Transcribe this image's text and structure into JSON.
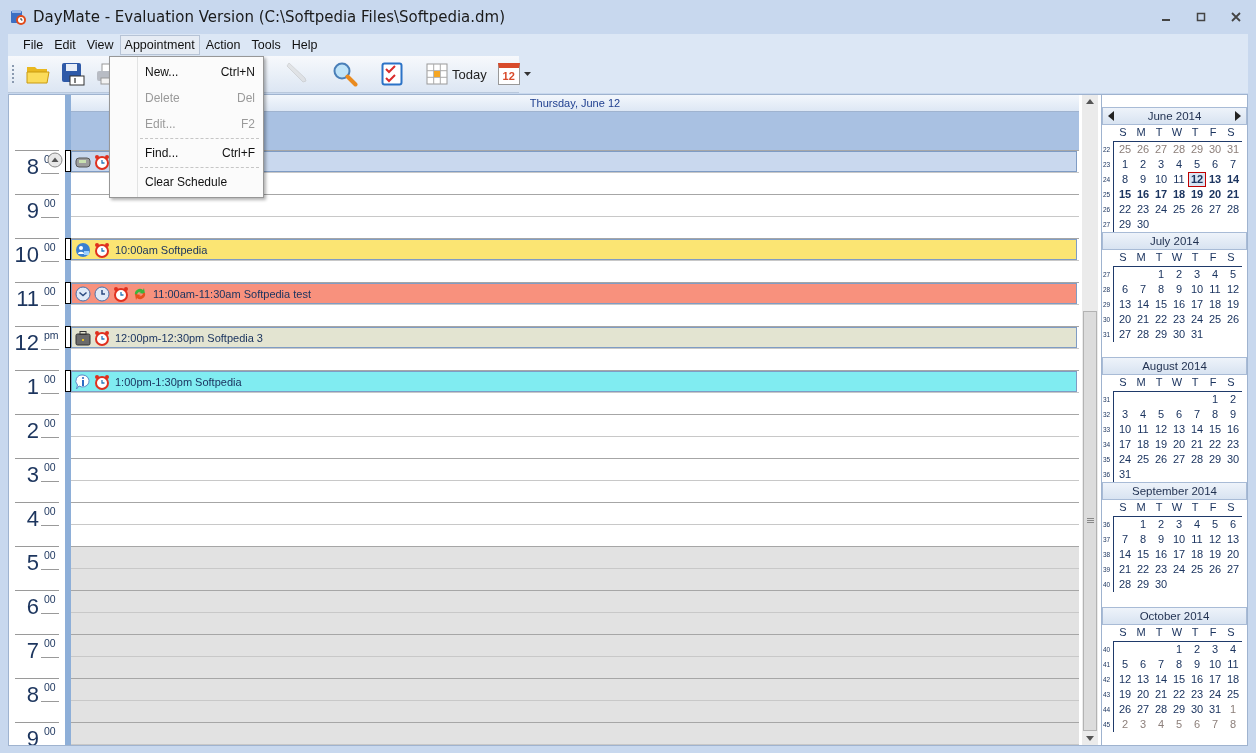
{
  "window": {
    "title": "DayMate - Evaluation Version (C:\\Softpedia Files\\Softpedia.dm)"
  },
  "menu_bar": [
    {
      "label": "File",
      "selected": false
    },
    {
      "label": "Edit",
      "selected": false
    },
    {
      "label": "View",
      "selected": false
    },
    {
      "label": "Appointment",
      "selected": true
    },
    {
      "label": "Action",
      "selected": false
    },
    {
      "label": "Tools",
      "selected": false
    },
    {
      "label": "Help",
      "selected": false
    }
  ],
  "toolbar": [
    {
      "kind": "open",
      "disabled": false
    },
    {
      "kind": "save",
      "disabled": false
    },
    {
      "kind": "print",
      "disabled": false
    },
    {
      "kind": "edit",
      "disabled": true
    },
    {
      "kind": "find",
      "disabled": false
    },
    {
      "kind": "tasks",
      "disabled": false
    },
    {
      "kind": "today",
      "label": "Today",
      "disabled": false
    },
    {
      "kind": "calendar",
      "label": "12",
      "disabled": false
    }
  ],
  "open_menu": [
    {
      "kind": "item",
      "label": "New...",
      "shortcut": "Ctrl+N",
      "disabled": false
    },
    {
      "kind": "item",
      "label": "Delete",
      "shortcut": "Del",
      "disabled": true
    },
    {
      "kind": "item",
      "label": "Edit...",
      "shortcut": "F2",
      "disabled": true
    },
    {
      "kind": "separator"
    },
    {
      "kind": "item",
      "label": "Find...",
      "shortcut": "Ctrl+F",
      "disabled": false
    },
    {
      "kind": "separator"
    },
    {
      "kind": "item",
      "label": "Clear Schedule",
      "disabled": false
    }
  ],
  "day_view": {
    "header": "Thursday, June 12",
    "hours": [
      {
        "hour": "8",
        "minutes": "0",
        "off": false,
        "appointment": {
          "kind": "message",
          "color": "#c9d8ee",
          "alarm": true,
          "recurring": false,
          "clock": false
        }
      },
      {
        "hour": "9",
        "minutes": "00",
        "off": false
      },
      {
        "hour": "10",
        "minutes": "00",
        "off": false,
        "appointment": {
          "kind": "call",
          "color": "#fbe573",
          "alarm": true,
          "recurring": false,
          "clock": false,
          "title": "10:00am Softpedia"
        }
      },
      {
        "hour": "11",
        "minutes": "00",
        "off": false,
        "appointment": {
          "kind": "reminder",
          "color": "#f8917d",
          "alarm": true,
          "recurring": true,
          "clock": true,
          "title": "11:00am-11:30am Softpedia test"
        }
      },
      {
        "hour": "12",
        "minutes": "pm",
        "off": false,
        "appointment": {
          "kind": "business",
          "color": "#e3e4d1",
          "alarm": true,
          "recurring": false,
          "clock": false,
          "title": "12:00pm-12:30pm Softpedia 3"
        }
      },
      {
        "hour": "1",
        "minutes": "00",
        "off": false,
        "appointment": {
          "kind": "info",
          "color": "#80ecf1",
          "alarm": true,
          "recurring": false,
          "clock": false,
          "title": "1:00pm-1:30pm Softpedia"
        }
      },
      {
        "hour": "2",
        "minutes": "00",
        "off": false
      },
      {
        "hour": "3",
        "minutes": "00",
        "off": false
      },
      {
        "hour": "4",
        "minutes": "00",
        "off": false
      },
      {
        "hour": "5",
        "minutes": "00",
        "off": true
      },
      {
        "hour": "6",
        "minutes": "00",
        "off": true
      },
      {
        "hour": "7",
        "minutes": "00",
        "off": true
      },
      {
        "hour": "8",
        "minutes": "00",
        "off": true
      },
      {
        "hour": "9",
        "minutes": "00",
        "off": true
      }
    ]
  },
  "mini_calendars": [
    {
      "title": "June 2014",
      "nav": true,
      "weekdays": [
        "S",
        "M",
        "T",
        "W",
        "T",
        "F",
        "S"
      ],
      "weeks": [
        {
          "wk": "22",
          "days": [
            {
              "t": "25",
              "muted": true,
              "bold": false,
              "selected": false
            },
            {
              "t": "26",
              "muted": true,
              "bold": false,
              "selected": false
            },
            {
              "t": "27",
              "muted": true,
              "bold": false,
              "selected": false
            },
            {
              "t": "28",
              "muted": true,
              "bold": false,
              "selected": false
            },
            {
              "t": "29",
              "muted": true,
              "bold": false,
              "selected": false
            },
            {
              "t": "30",
              "muted": true,
              "bold": false,
              "selected": false
            },
            {
              "t": "31",
              "muted": true,
              "bold": false,
              "selected": false
            }
          ]
        },
        {
          "wk": "23",
          "days": [
            {
              "t": "1",
              "muted": false,
              "bold": false,
              "selected": false
            },
            {
              "t": "2",
              "muted": false,
              "bold": false,
              "selected": false
            },
            {
              "t": "3",
              "muted": false,
              "bold": false,
              "selected": false
            },
            {
              "t": "4",
              "muted": false,
              "bold": false,
              "selected": false
            },
            {
              "t": "5",
              "muted": false,
              "bold": false,
              "selected": false
            },
            {
              "t": "6",
              "muted": false,
              "bold": false,
              "selected": false
            },
            {
              "t": "7",
              "muted": false,
              "bold": false,
              "selected": false
            }
          ]
        },
        {
          "wk": "24",
          "days": [
            {
              "t": "8",
              "muted": false,
              "bold": false,
              "selected": false
            },
            {
              "t": "9",
              "muted": false,
              "bold": false,
              "selected": false
            },
            {
              "t": "10",
              "muted": false,
              "bold": false,
              "selected": false
            },
            {
              "t": "11",
              "muted": false,
              "bold": false,
              "selected": false
            },
            {
              "t": "12",
              "muted": false,
              "bold": true,
              "selected": true
            },
            {
              "t": "13",
              "muted": false,
              "bold": true,
              "selected": false
            },
            {
              "t": "14",
              "muted": false,
              "bold": true,
              "selected": false
            }
          ]
        },
        {
          "wk": "25",
          "days": [
            {
              "t": "15",
              "muted": false,
              "bold": true,
              "selected": false
            },
            {
              "t": "16",
              "muted": false,
              "bold": true,
              "selected": false
            },
            {
              "t": "17",
              "muted": false,
              "bold": true,
              "selected": false
            },
            {
              "t": "18",
              "muted": false,
              "bold": true,
              "selected": false
            },
            {
              "t": "19",
              "muted": false,
              "bold": true,
              "selected": false
            },
            {
              "t": "20",
              "muted": false,
              "bold": true,
              "selected": false
            },
            {
              "t": "21",
              "muted": false,
              "bold": true,
              "selected": false
            }
          ]
        },
        {
          "wk": "26",
          "days": [
            {
              "t": "22",
              "muted": false,
              "bold": false,
              "selected": false
            },
            {
              "t": "23",
              "muted": false,
              "bold": false,
              "selected": false
            },
            {
              "t": "24",
              "muted": false,
              "bold": false,
              "selected": false
            },
            {
              "t": "25",
              "muted": false,
              "bold": false,
              "selected": false
            },
            {
              "t": "26",
              "muted": false,
              "bold": false,
              "selected": false
            },
            {
              "t": "27",
              "muted": false,
              "bold": false,
              "selected": false
            },
            {
              "t": "28",
              "muted": false,
              "bold": false,
              "selected": false
            }
          ]
        },
        {
          "wk": "27",
          "days": [
            {
              "t": "29",
              "muted": false,
              "bold": false,
              "selected": false
            },
            {
              "t": "30",
              "muted": false,
              "bold": false,
              "selected": false
            }
          ]
        }
      ]
    },
    {
      "title": "July 2014",
      "nav": false,
      "weekdays": [
        "S",
        "M",
        "T",
        "W",
        "T",
        "F",
        "S"
      ],
      "weeks": [
        {
          "wk": "27",
          "days": [
            {
              "blank": true
            },
            {
              "blank": true
            },
            {
              "t": "1",
              "muted": false,
              "bold": false,
              "selected": false
            },
            {
              "t": "2",
              "muted": false,
              "bold": false,
              "selected": false
            },
            {
              "t": "3",
              "muted": false,
              "bold": false,
              "selected": false
            },
            {
              "t": "4",
              "muted": false,
              "bold": false,
              "selected": false
            },
            {
              "t": "5",
              "muted": false,
              "bold": false,
              "selected": false
            }
          ]
        },
        {
          "wk": "28",
          "days": [
            {
              "t": "6",
              "muted": false,
              "bold": false,
              "selected": false
            },
            {
              "t": "7",
              "muted": false,
              "bold": false,
              "selected": false
            },
            {
              "t": "8",
              "muted": false,
              "bold": false,
              "selected": false
            },
            {
              "t": "9",
              "muted": false,
              "bold": false,
              "selected": false
            },
            {
              "t": "10",
              "muted": false,
              "bold": false,
              "selected": false
            },
            {
              "t": "11",
              "muted": false,
              "bold": false,
              "selected": false
            },
            {
              "t": "12",
              "muted": false,
              "bold": false,
              "selected": false
            }
          ]
        },
        {
          "wk": "29",
          "days": [
            {
              "t": "13",
              "muted": false,
              "bold": false,
              "selected": false
            },
            {
              "t": "14",
              "muted": false,
              "bold": false,
              "selected": false
            },
            {
              "t": "15",
              "muted": false,
              "bold": false,
              "selected": false
            },
            {
              "t": "16",
              "muted": false,
              "bold": false,
              "selected": false
            },
            {
              "t": "17",
              "muted": false,
              "bold": false,
              "selected": false
            },
            {
              "t": "18",
              "muted": false,
              "bold": false,
              "selected": false
            },
            {
              "t": "19",
              "muted": false,
              "bold": false,
              "selected": false
            }
          ]
        },
        {
          "wk": "30",
          "days": [
            {
              "t": "20",
              "muted": false,
              "bold": false,
              "selected": false
            },
            {
              "t": "21",
              "muted": false,
              "bold": false,
              "selected": false
            },
            {
              "t": "22",
              "muted": false,
              "bold": false,
              "selected": false
            },
            {
              "t": "23",
              "muted": false,
              "bold": false,
              "selected": false
            },
            {
              "t": "24",
              "muted": false,
              "bold": false,
              "selected": false
            },
            {
              "t": "25",
              "muted": false,
              "bold": false,
              "selected": false
            },
            {
              "t": "26",
              "muted": false,
              "bold": false,
              "selected": false
            }
          ]
        },
        {
          "wk": "31",
          "days": [
            {
              "t": "27",
              "muted": false,
              "bold": false,
              "selected": false
            },
            {
              "t": "28",
              "muted": false,
              "bold": false,
              "selected": false
            },
            {
              "t": "29",
              "muted": false,
              "bold": false,
              "selected": false
            },
            {
              "t": "30",
              "muted": false,
              "bold": false,
              "selected": false
            },
            {
              "t": "31",
              "muted": false,
              "bold": false,
              "selected": false
            }
          ]
        }
      ]
    },
    {
      "title": "August 2014",
      "nav": false,
      "weekdays": [
        "S",
        "M",
        "T",
        "W",
        "T",
        "F",
        "S"
      ],
      "weeks": [
        {
          "wk": "31",
          "days": [
            {
              "blank": true
            },
            {
              "blank": true
            },
            {
              "blank": true
            },
            {
              "blank": true
            },
            {
              "blank": true
            },
            {
              "t": "1",
              "muted": false,
              "bold": false,
              "selected": false
            },
            {
              "t": "2",
              "muted": false,
              "bold": false,
              "selected": false
            }
          ]
        },
        {
          "wk": "32",
          "days": [
            {
              "t": "3",
              "muted": false,
              "bold": false,
              "selected": false
            },
            {
              "t": "4",
              "muted": false,
              "bold": false,
              "selected": false
            },
            {
              "t": "5",
              "muted": false,
              "bold": false,
              "selected": false
            },
            {
              "t": "6",
              "muted": false,
              "bold": false,
              "selected": false
            },
            {
              "t": "7",
              "muted": false,
              "bold": false,
              "selected": false
            },
            {
              "t": "8",
              "muted": false,
              "bold": false,
              "selected": false
            },
            {
              "t": "9",
              "muted": false,
              "bold": false,
              "selected": false
            }
          ]
        },
        {
          "wk": "33",
          "days": [
            {
              "t": "10",
              "muted": false,
              "bold": false,
              "selected": false
            },
            {
              "t": "11",
              "muted": false,
              "bold": false,
              "selected": false
            },
            {
              "t": "12",
              "muted": false,
              "bold": false,
              "selected": false
            },
            {
              "t": "13",
              "muted": false,
              "bold": false,
              "selected": false
            },
            {
              "t": "14",
              "muted": false,
              "bold": false,
              "selected": false
            },
            {
              "t": "15",
              "muted": false,
              "bold": false,
              "selected": false
            },
            {
              "t": "16",
              "muted": false,
              "bold": false,
              "selected": false
            }
          ]
        },
        {
          "wk": "34",
          "days": [
            {
              "t": "17",
              "muted": false,
              "bold": false,
              "selected": false
            },
            {
              "t": "18",
              "muted": false,
              "bold": false,
              "selected": false
            },
            {
              "t": "19",
              "muted": false,
              "bold": false,
              "selected": false
            },
            {
              "t": "20",
              "muted": false,
              "bold": false,
              "selected": false
            },
            {
              "t": "21",
              "muted": false,
              "bold": false,
              "selected": false
            },
            {
              "t": "22",
              "muted": false,
              "bold": false,
              "selected": false
            },
            {
              "t": "23",
              "muted": false,
              "bold": false,
              "selected": false
            }
          ]
        },
        {
          "wk": "35",
          "days": [
            {
              "t": "24",
              "muted": false,
              "bold": false,
              "selected": false
            },
            {
              "t": "25",
              "muted": false,
              "bold": false,
              "selected": false
            },
            {
              "t": "26",
              "muted": false,
              "bold": false,
              "selected": false
            },
            {
              "t": "27",
              "muted": false,
              "bold": false,
              "selected": false
            },
            {
              "t": "28",
              "muted": false,
              "bold": false,
              "selected": false
            },
            {
              "t": "29",
              "muted": false,
              "bold": false,
              "selected": false
            },
            {
              "t": "30",
              "muted": false,
              "bold": false,
              "selected": false
            }
          ]
        },
        {
          "wk": "36",
          "days": [
            {
              "t": "31",
              "muted": false,
              "bold": false,
              "selected": false
            }
          ]
        }
      ]
    },
    {
      "title": "September 2014",
      "nav": false,
      "weekdays": [
        "S",
        "M",
        "T",
        "W",
        "T",
        "F",
        "S"
      ],
      "weeks": [
        {
          "wk": "36",
          "days": [
            {
              "blank": true
            },
            {
              "t": "1",
              "muted": false,
              "bold": false,
              "selected": false
            },
            {
              "t": "2",
              "muted": false,
              "bold": false,
              "selected": false
            },
            {
              "t": "3",
              "muted": false,
              "bold": false,
              "selected": false
            },
            {
              "t": "4",
              "muted": false,
              "bold": false,
              "selected": false
            },
            {
              "t": "5",
              "muted": false,
              "bold": false,
              "selected": false
            },
            {
              "t": "6",
              "muted": false,
              "bold": false,
              "selected": false
            }
          ]
        },
        {
          "wk": "37",
          "days": [
            {
              "t": "7",
              "muted": false,
              "bold": false,
              "selected": false
            },
            {
              "t": "8",
              "muted": false,
              "bold": false,
              "selected": false
            },
            {
              "t": "9",
              "muted": false,
              "bold": false,
              "selected": false
            },
            {
              "t": "10",
              "muted": false,
              "bold": false,
              "selected": false
            },
            {
              "t": "11",
              "muted": false,
              "bold": false,
              "selected": false
            },
            {
              "t": "12",
              "muted": false,
              "bold": false,
              "selected": false
            },
            {
              "t": "13",
              "muted": false,
              "bold": false,
              "selected": false
            }
          ]
        },
        {
          "wk": "38",
          "days": [
            {
              "t": "14",
              "muted": false,
              "bold": false,
              "selected": false
            },
            {
              "t": "15",
              "muted": false,
              "bold": false,
              "selected": false
            },
            {
              "t": "16",
              "muted": false,
              "bold": false,
              "selected": false
            },
            {
              "t": "17",
              "muted": false,
              "bold": false,
              "selected": false
            },
            {
              "t": "18",
              "muted": false,
              "bold": false,
              "selected": false
            },
            {
              "t": "19",
              "muted": false,
              "bold": false,
              "selected": false
            },
            {
              "t": "20",
              "muted": false,
              "bold": false,
              "selected": false
            }
          ]
        },
        {
          "wk": "39",
          "days": [
            {
              "t": "21",
              "muted": false,
              "bold": false,
              "selected": false
            },
            {
              "t": "22",
              "muted": false,
              "bold": false,
              "selected": false
            },
            {
              "t": "23",
              "muted": false,
              "bold": false,
              "selected": false
            },
            {
              "t": "24",
              "muted": false,
              "bold": false,
              "selected": false
            },
            {
              "t": "25",
              "muted": false,
              "bold": false,
              "selected": false
            },
            {
              "t": "26",
              "muted": false,
              "bold": false,
              "selected": false
            },
            {
              "t": "27",
              "muted": false,
              "bold": false,
              "selected": false
            }
          ]
        },
        {
          "wk": "40",
          "days": [
            {
              "t": "28",
              "muted": false,
              "bold": false,
              "selected": false
            },
            {
              "t": "29",
              "muted": false,
              "bold": false,
              "selected": false
            },
            {
              "t": "30",
              "muted": false,
              "bold": false,
              "selected": false
            }
          ]
        }
      ]
    },
    {
      "title": "October 2014",
      "nav": false,
      "weekdays": [
        "S",
        "M",
        "T",
        "W",
        "T",
        "F",
        "S"
      ],
      "weeks": [
        {
          "wk": "40",
          "days": [
            {
              "blank": true
            },
            {
              "blank": true
            },
            {
              "blank": true
            },
            {
              "t": "1",
              "muted": false,
              "bold": false,
              "selected": false
            },
            {
              "t": "2",
              "muted": false,
              "bold": false,
              "selected": false
            },
            {
              "t": "3",
              "muted": false,
              "bold": false,
              "selected": false
            },
            {
              "t": "4",
              "muted": false,
              "bold": false,
              "selected": false
            }
          ]
        },
        {
          "wk": "41",
          "days": [
            {
              "t": "5",
              "muted": false,
              "bold": false,
              "selected": false
            },
            {
              "t": "6",
              "muted": false,
              "bold": false,
              "selected": false
            },
            {
              "t": "7",
              "muted": false,
              "bold": false,
              "selected": false
            },
            {
              "t": "8",
              "muted": false,
              "bold": false,
              "selected": false
            },
            {
              "t": "9",
              "muted": false,
              "bold": false,
              "selected": false
            },
            {
              "t": "10",
              "muted": false,
              "bold": false,
              "selected": false
            },
            {
              "t": "11",
              "muted": false,
              "bold": false,
              "selected": false
            }
          ]
        },
        {
          "wk": "42",
          "days": [
            {
              "t": "12",
              "muted": false,
              "bold": false,
              "selected": false
            },
            {
              "t": "13",
              "muted": false,
              "bold": false,
              "selected": false
            },
            {
              "t": "14",
              "muted": false,
              "bold": false,
              "selected": false
            },
            {
              "t": "15",
              "muted": false,
              "bold": false,
              "selected": false
            },
            {
              "t": "16",
              "muted": false,
              "bold": false,
              "selected": false
            },
            {
              "t": "17",
              "muted": false,
              "bold": false,
              "selected": false
            },
            {
              "t": "18",
              "muted": false,
              "bold": false,
              "selected": false
            }
          ]
        },
        {
          "wk": "43",
          "days": [
            {
              "t": "19",
              "muted": false,
              "bold": false,
              "selected": false
            },
            {
              "t": "20",
              "muted": false,
              "bold": false,
              "selected": false
            },
            {
              "t": "21",
              "muted": false,
              "bold": false,
              "selected": false
            },
            {
              "t": "22",
              "muted": false,
              "bold": false,
              "selected": false
            },
            {
              "t": "23",
              "muted": false,
              "bold": false,
              "selected": false
            },
            {
              "t": "24",
              "muted": false,
              "bold": false,
              "selected": false
            },
            {
              "t": "25",
              "muted": false,
              "bold": false,
              "selected": false
            }
          ]
        },
        {
          "wk": "44",
          "days": [
            {
              "t": "26",
              "muted": false,
              "bold": false,
              "selected": false
            },
            {
              "t": "27",
              "muted": false,
              "bold": false,
              "selected": false
            },
            {
              "t": "28",
              "muted": false,
              "bold": false,
              "selected": false
            },
            {
              "t": "29",
              "muted": false,
              "bold": false,
              "selected": false
            },
            {
              "t": "30",
              "muted": false,
              "bold": false,
              "selected": false
            },
            {
              "t": "31",
              "muted": false,
              "bold": false,
              "selected": false
            },
            {
              "t": "1",
              "muted": true,
              "bold": false,
              "selected": false
            }
          ]
        },
        {
          "wk": "45",
          "days": [
            {
              "t": "2",
              "muted": true,
              "bold": false,
              "selected": false
            },
            {
              "t": "3",
              "muted": true,
              "bold": false,
              "selected": false
            },
            {
              "t": "4",
              "muted": true,
              "bold": false,
              "selected": false
            },
            {
              "t": "5",
              "muted": true,
              "bold": false,
              "selected": false
            },
            {
              "t": "6",
              "muted": true,
              "bold": false,
              "selected": false
            },
            {
              "t": "7",
              "muted": true,
              "bold": false,
              "selected": false
            },
            {
              "t": "8",
              "muted": true,
              "bold": false,
              "selected": false
            }
          ]
        }
      ]
    }
  ]
}
